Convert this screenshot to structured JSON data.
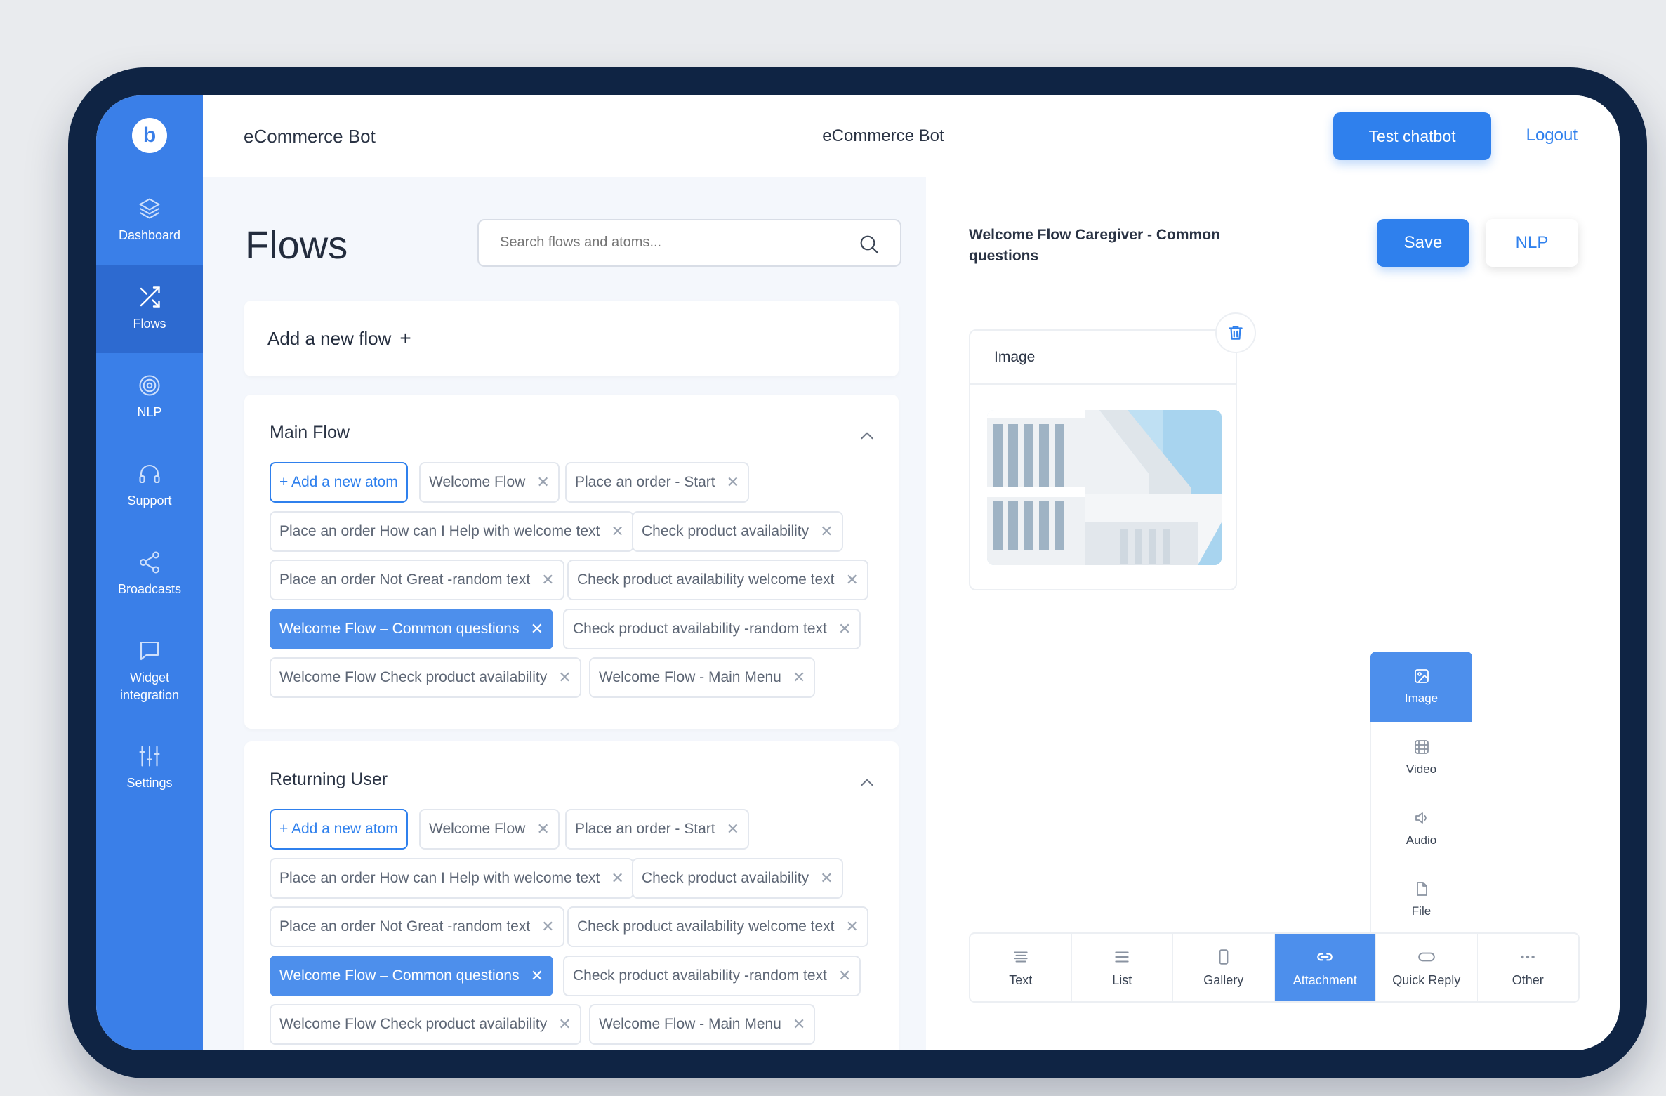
{
  "app": {
    "brand": "eCommerce Bot",
    "title": "eCommerce Bot",
    "logo_letter": "b"
  },
  "header": {
    "test_label": "Test chatbot",
    "logout_label": "Logout"
  },
  "sidebar": {
    "items": [
      {
        "label": "Dashboard",
        "icon": "layers-icon"
      },
      {
        "label": "Flows",
        "icon": "shuffle-icon",
        "active": true
      },
      {
        "label": "NLP",
        "icon": "target-icon"
      },
      {
        "label": "Support",
        "icon": "headphones-icon"
      },
      {
        "label": "Broadcasts",
        "icon": "share-icon"
      },
      {
        "label": "Widget integration",
        "icon": "chat-icon"
      },
      {
        "label": "Settings",
        "icon": "sliders-icon"
      }
    ]
  },
  "flows": {
    "title": "Flows",
    "search_placeholder": "Search flows and atoms...",
    "add_flow_label": "Add a new flow",
    "add_flow_plus": "+",
    "groups": [
      {
        "name": "Main Flow",
        "add_atom_label": "+ Add a new atom",
        "tags": [
          "Welcome Flow",
          "Place an order - Start",
          "Place an order How can I Help with welcome text",
          "Check product availability",
          "Place an order Not Great -random text",
          "Check product availability welcome text",
          "Welcome Flow  – Common questions",
          "Check product availability -random text",
          "Welcome Flow Check product availability",
          "Welcome Flow - Main Menu"
        ],
        "selected_tag": "Welcome Flow  – Common questions"
      },
      {
        "name": "Returning User",
        "add_atom_label": "+ Add a new atom",
        "tags": [
          "Welcome Flow",
          "Place an order - Start",
          "Place an order How can I Help with welcome text",
          "Check product availability",
          "Place an order Not Great -random text",
          "Check product availability welcome text",
          "Welcome Flow  – Common questions",
          "Check product availability -random text",
          "Welcome Flow Check product availability",
          "Welcome Flow - Main Menu"
        ],
        "selected_tag": "Welcome Flow  – Common questions"
      }
    ]
  },
  "editor": {
    "title": "Welcome Flow Caregiver - Common questions",
    "save_label": "Save",
    "nlp_label": "NLP",
    "image_card_title": "Image",
    "attachment_menu": [
      {
        "label": "Image",
        "icon": "image-icon",
        "active": true
      },
      {
        "label": "Video",
        "icon": "film-icon"
      },
      {
        "label": "Audio",
        "icon": "speaker-icon"
      },
      {
        "label": "File",
        "icon": "file-icon"
      }
    ],
    "toolbar": [
      {
        "label": "Text",
        "icon": "text-lines-icon"
      },
      {
        "label": "List",
        "icon": "list-icon"
      },
      {
        "label": "Gallery",
        "icon": "gallery-icon"
      },
      {
        "label": "Attachment",
        "icon": "link-icon",
        "active": true
      },
      {
        "label": "Quick Reply",
        "icon": "pill-icon"
      },
      {
        "label": "Other",
        "icon": "more-icon"
      }
    ]
  },
  "colors": {
    "primary": "#2f80ed",
    "sidebar": "#3a7fe8",
    "frame": "#0f2444",
    "selected_tag": "#4d8fec"
  }
}
